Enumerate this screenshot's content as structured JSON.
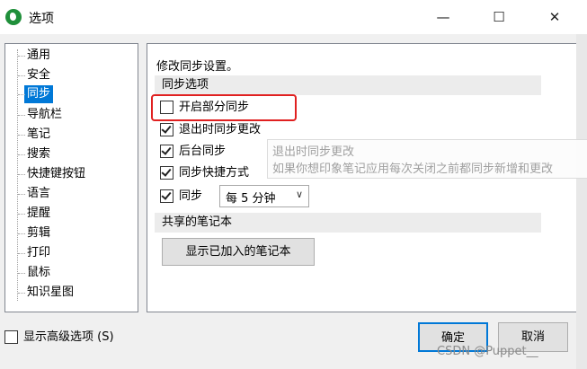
{
  "window": {
    "title": "选项"
  },
  "nav": {
    "items": [
      {
        "label": "通用"
      },
      {
        "label": "安全"
      },
      {
        "label": "同步"
      },
      {
        "label": "导航栏"
      },
      {
        "label": "笔记"
      },
      {
        "label": "搜索"
      },
      {
        "label": "快捷键按钮"
      },
      {
        "label": "语言"
      },
      {
        "label": "提醒"
      },
      {
        "label": "剪辑"
      },
      {
        "label": "打印"
      },
      {
        "label": "鼠标"
      },
      {
        "label": "知识星图"
      }
    ],
    "selected": "同步"
  },
  "sync": {
    "intro": "修改同步设置。",
    "section_title": "同步选项",
    "options": [
      {
        "label": "开启部分同步",
        "checked": false
      },
      {
        "label": "退出时同步更改",
        "checked": true
      },
      {
        "label": "后台同步",
        "checked": true
      },
      {
        "label": "同步快捷方式",
        "checked": true
      }
    ],
    "interval": {
      "label": "同步",
      "checked": true,
      "value": "每 5 分钟"
    },
    "shared_section_title": "共享的笔记本",
    "show_notebooks_button": "显示已加入的笔记本"
  },
  "tooltip": {
    "title": "退出时同步更改",
    "body": "如果你想印象笔记应用每次关闭之前都同步新增和更改"
  },
  "footer": {
    "advanced_label": "显示高级选项 (S)",
    "advanced_checked": false,
    "ok_label": "确定",
    "cancel_label": "取消"
  },
  "watermark": "CSDN @Puppet__",
  "colors": {
    "accent": "#0078d7",
    "highlight": "#e02020"
  }
}
